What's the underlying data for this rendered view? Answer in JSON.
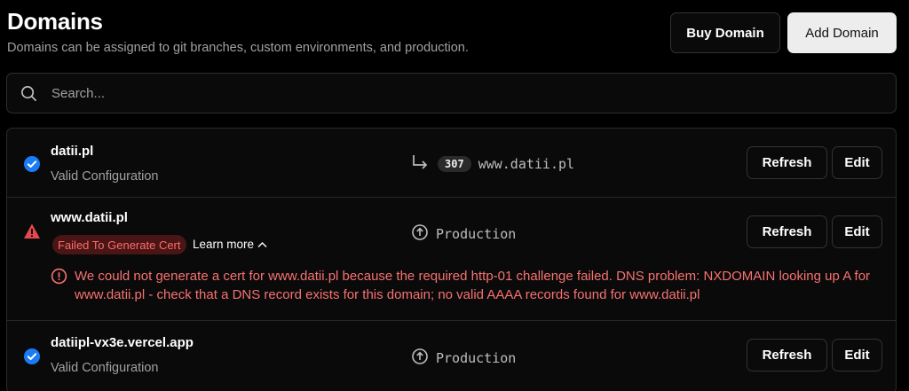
{
  "header": {
    "title": "Domains",
    "subtitle": "Domains can be assigned to git branches, custom environments, and production.",
    "buy_label": "Buy Domain",
    "add_label": "Add Domain"
  },
  "search": {
    "placeholder": "Search..."
  },
  "colors": {
    "success": "#1a7cf5",
    "error": "#f87171",
    "warning": "#e5484d"
  },
  "domains": [
    {
      "name": "datii.pl",
      "status": "Valid Configuration",
      "status_icon": "check-circle-icon",
      "redirect_code": "307",
      "target": "www.datii.pl",
      "target_icon": "redirect-arrow-icon",
      "refresh_label": "Refresh",
      "edit_label": "Edit"
    },
    {
      "name": "www.datii.pl",
      "status_icon": "warning-triangle-icon",
      "error_badge": "Failed To Generate Cert",
      "learn_more": "Learn more",
      "error_message": "We could not generate a cert for www.datii.pl because the required http-01 challenge failed. DNS problem: NXDOMAIN looking up A for www.datii.pl - check that a DNS record exists for this domain; no valid AAAA records found for www.datii.pl",
      "target": "Production",
      "target_icon": "arrow-up-circle-icon",
      "refresh_label": "Refresh",
      "edit_label": "Edit"
    },
    {
      "name": "datiipl-vx3e.vercel.app",
      "status": "Valid Configuration",
      "status_icon": "check-circle-icon",
      "target": "Production",
      "target_icon": "arrow-up-circle-icon",
      "refresh_label": "Refresh",
      "edit_label": "Edit"
    }
  ]
}
